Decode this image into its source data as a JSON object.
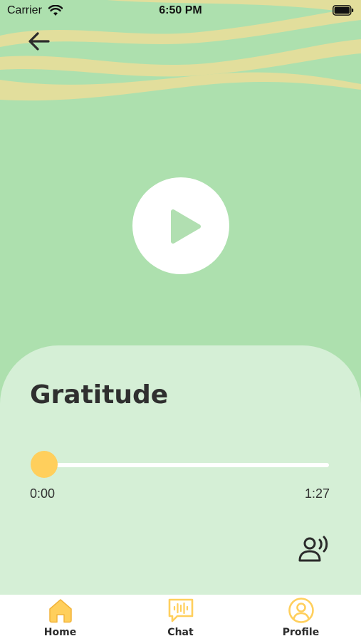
{
  "status_bar": {
    "carrier": "Carrier",
    "time": "6:50 PM",
    "icons": [
      "wifi-icon",
      "battery-icon"
    ]
  },
  "navigation": {
    "back_icon": "arrow-left-icon"
  },
  "player": {
    "play_icon": "play-icon",
    "title": "Gratitude",
    "progress_fraction": 0.0,
    "current_time": "0:00",
    "duration": "1:27",
    "voice_icon": "speaking-person-icon"
  },
  "tab_bar": {
    "tabs": [
      {
        "label": "Home",
        "icon": "home-icon"
      },
      {
        "label": "Chat",
        "icon": "chat-icon"
      },
      {
        "label": "Profile",
        "icon": "profile-icon"
      }
    ]
  },
  "colors": {
    "background_green": "#ade0ae",
    "sheet_green": "#d5efd6",
    "wave_yellow": "#e2de9c",
    "accent_yellow": "#ffcf5c",
    "white": "#ffffff",
    "text_dark": "#2f2f2f"
  }
}
